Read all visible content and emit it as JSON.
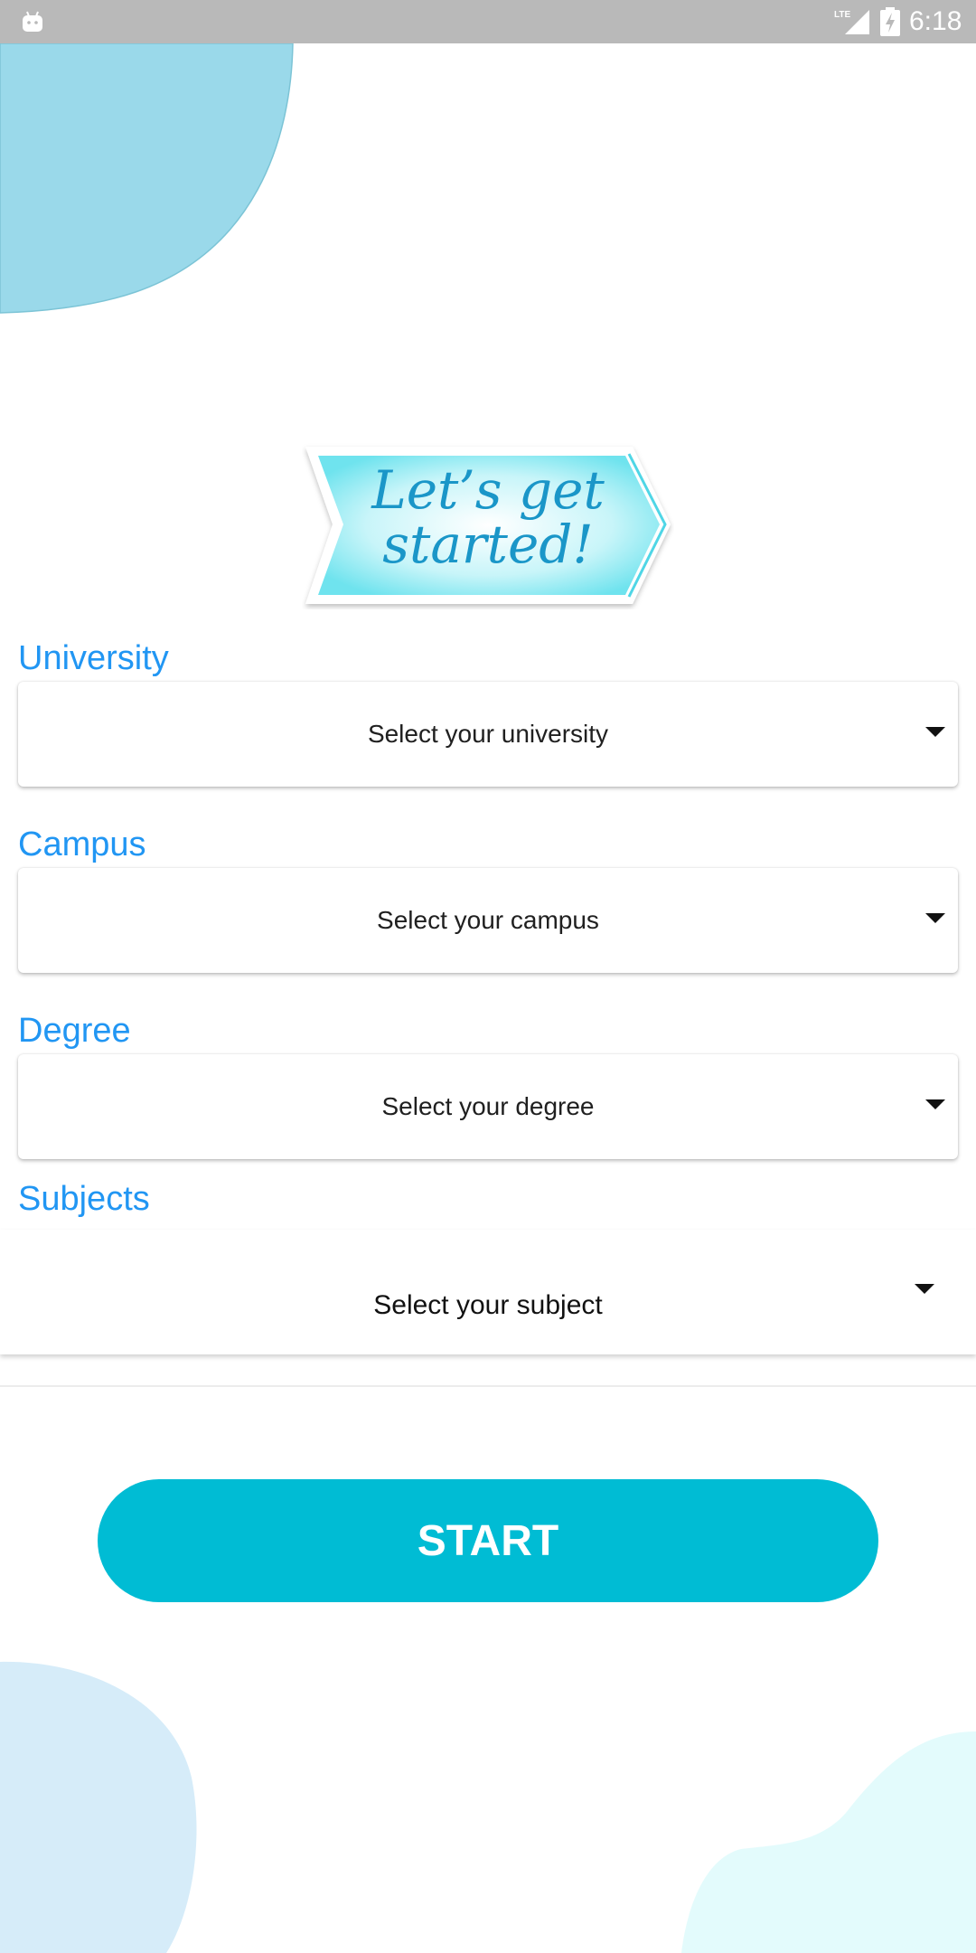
{
  "status_bar": {
    "network_label": "LTE",
    "time": "6:18"
  },
  "banner": {
    "line1": "Let’s get",
    "line2": "started!"
  },
  "form": {
    "university": {
      "label": "University",
      "placeholder": "Select your university"
    },
    "campus": {
      "label": "Campus",
      "placeholder": "Select your campus"
    },
    "degree": {
      "label": "Degree",
      "placeholder": "Select your degree"
    },
    "subjects": {
      "label": "Subjects",
      "placeholder": "Select your subject"
    }
  },
  "start_button": {
    "label": "START"
  },
  "colors": {
    "accent": "#2196f3",
    "button": "#00bcd4",
    "banner_text": "#1a96c8",
    "status_bar": "#b9b9b9",
    "blob_top_left": "#9ad9ea",
    "blob_bottom_left": "#d6ecf9",
    "blob_bottom_right": "#e3fbfc"
  },
  "icons": {
    "status_left": "android-icon",
    "signal": "lte-signal-icon",
    "battery": "battery-charging-icon",
    "dropdown": "chevron-down-icon"
  }
}
